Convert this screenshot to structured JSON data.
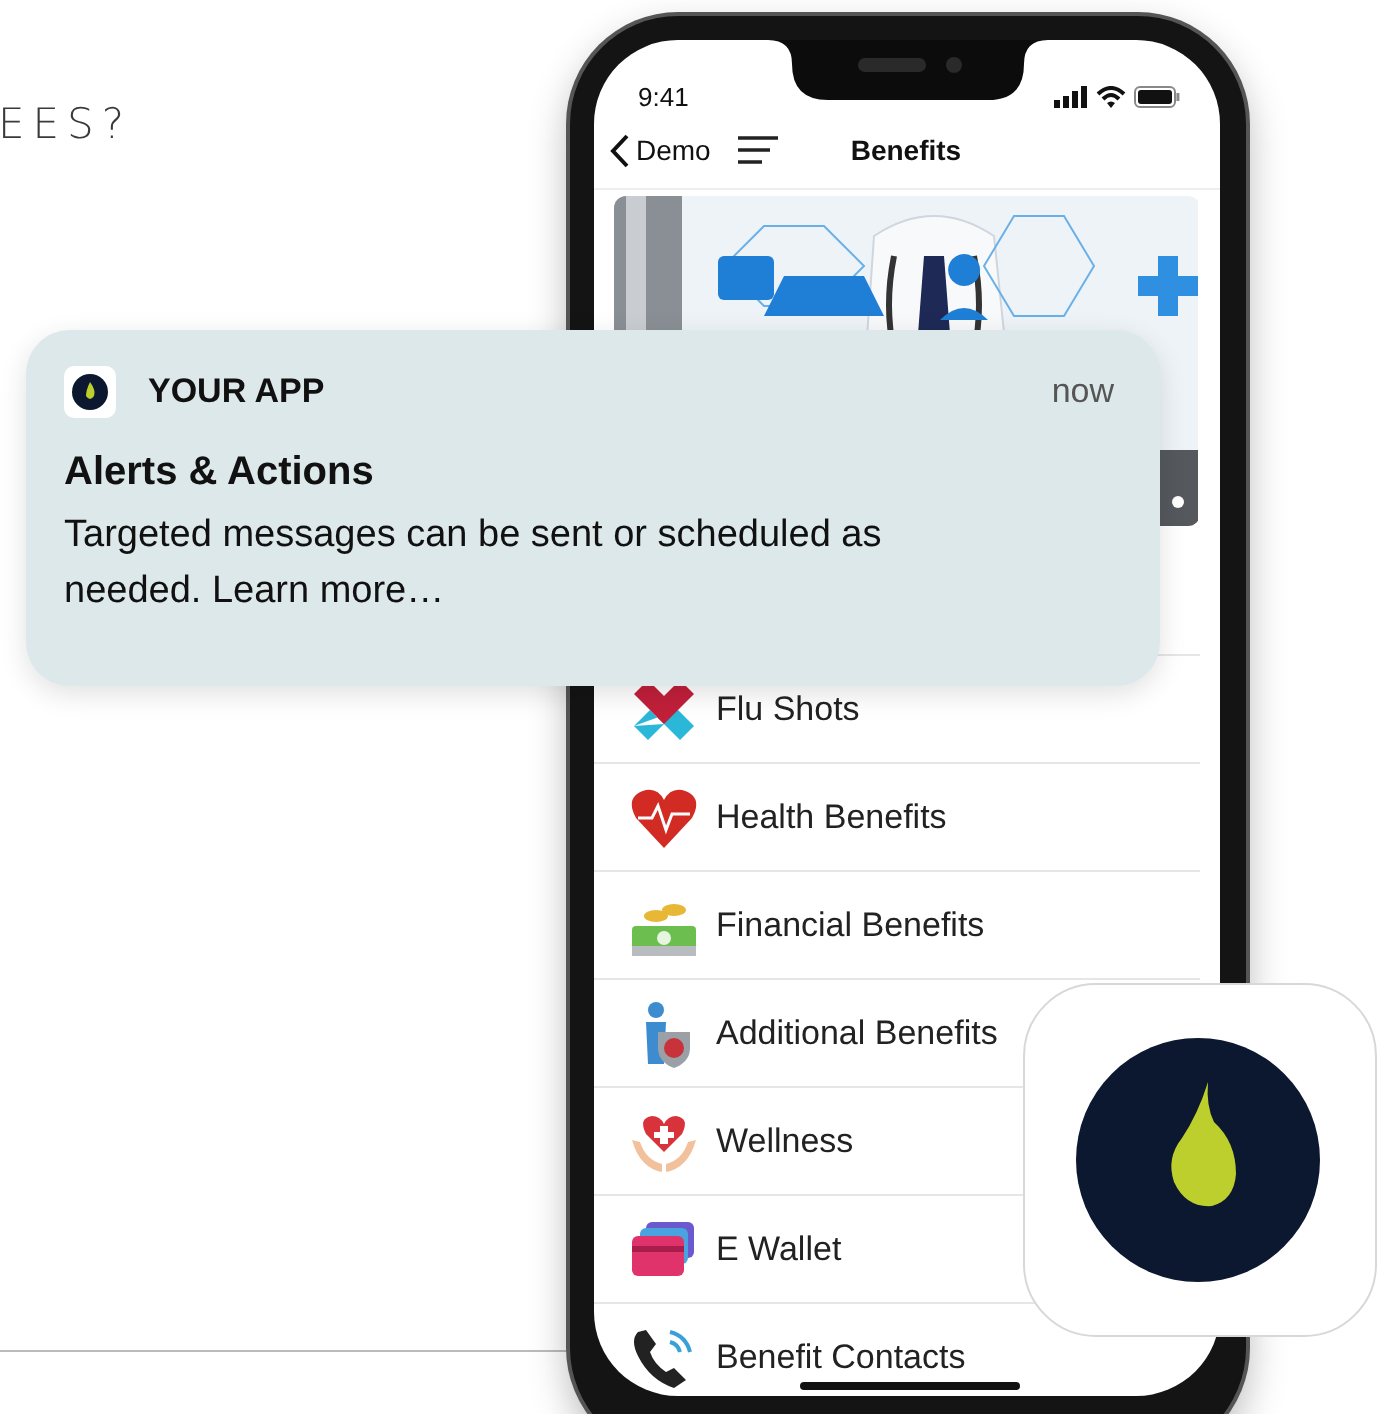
{
  "heading": "EES?",
  "phone": {
    "status_time": "9:41",
    "back_label": "Demo",
    "title": "Benefits",
    "items": [
      {
        "label": "Flu Shots"
      },
      {
        "label": "Health Benefits"
      },
      {
        "label": "Financial Benefits"
      },
      {
        "label": "Additional Benefits"
      },
      {
        "label": "Wellness"
      },
      {
        "label": "E Wallet"
      },
      {
        "label": "Benefit Contacts"
      }
    ]
  },
  "notification": {
    "app_name": "YOUR APP",
    "time": "now",
    "title": "Alerts & Actions",
    "body": "Targeted messages can be sent or scheduled as needed. Learn more…"
  }
}
